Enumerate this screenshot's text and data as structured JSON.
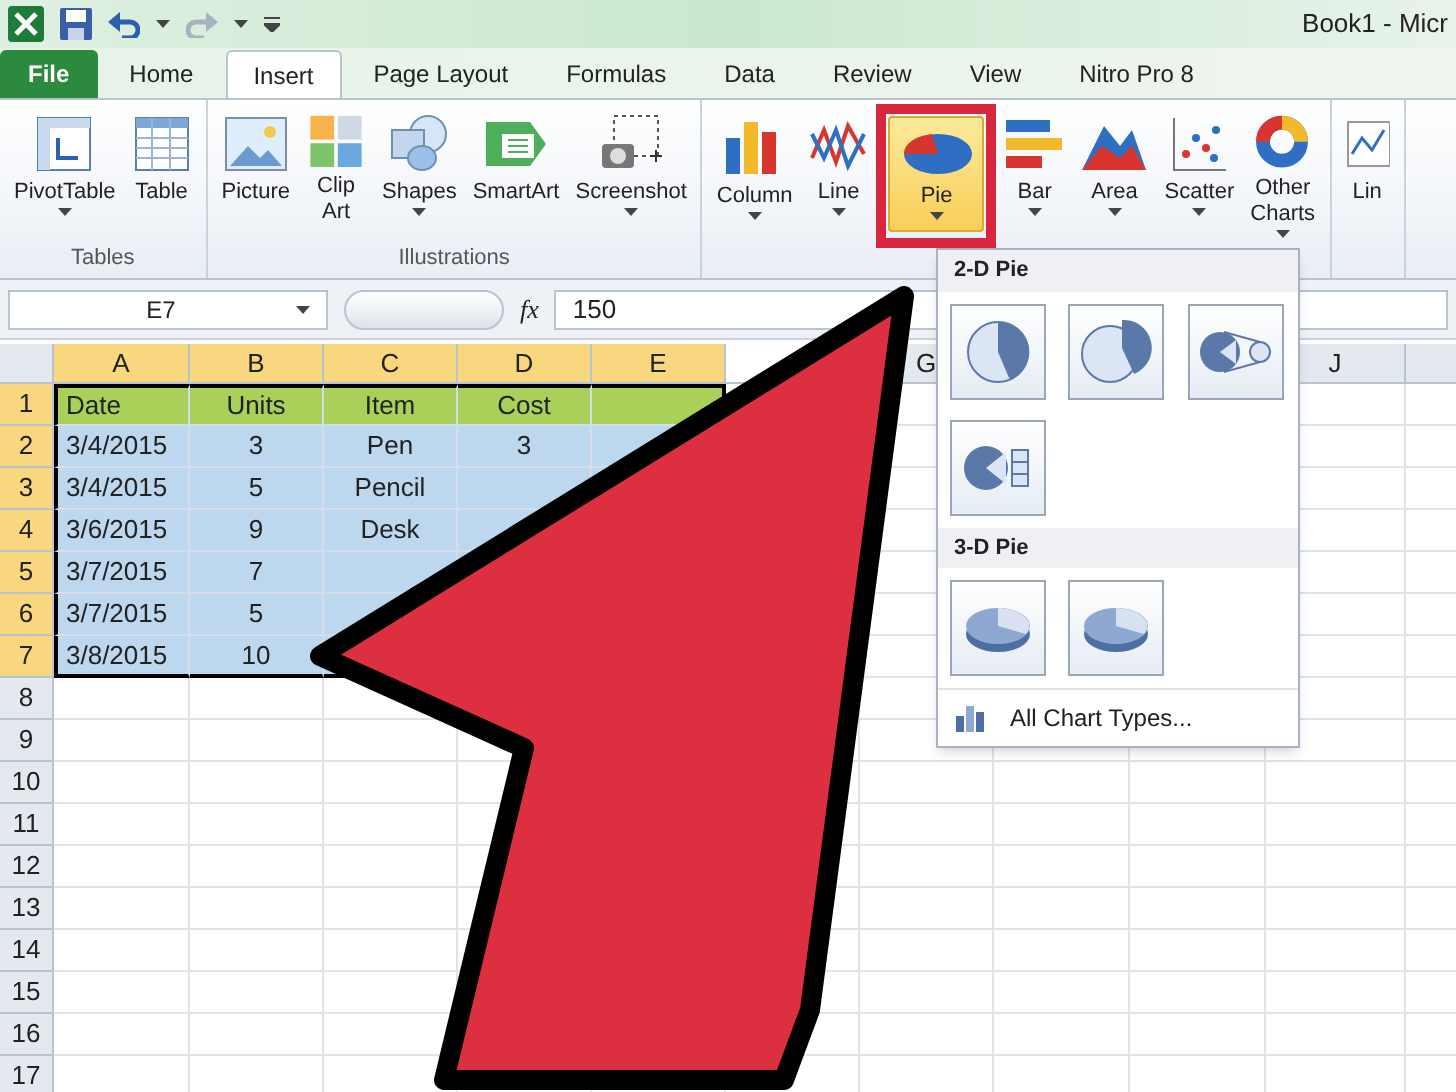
{
  "window": {
    "title": "Book1 - Micr"
  },
  "tabs": [
    {
      "label": "File",
      "kind": "file",
      "selected": false
    },
    {
      "label": "Home",
      "kind": "tab",
      "selected": false
    },
    {
      "label": "Insert",
      "kind": "tab",
      "selected": true
    },
    {
      "label": "Page Layout",
      "kind": "tab",
      "selected": false
    },
    {
      "label": "Formulas",
      "kind": "tab",
      "selected": false
    },
    {
      "label": "Data",
      "kind": "tab",
      "selected": false
    },
    {
      "label": "Review",
      "kind": "tab",
      "selected": false
    },
    {
      "label": "View",
      "kind": "tab",
      "selected": false
    },
    {
      "label": "Nitro Pro 8",
      "kind": "tab",
      "selected": false
    }
  ],
  "ribbon": {
    "groups": [
      {
        "label": "Tables",
        "buttons": [
          {
            "label": "PivotTable",
            "dropdown": true,
            "selected": false
          },
          {
            "label": "Table",
            "dropdown": false,
            "selected": false
          }
        ]
      },
      {
        "label": "Illustrations",
        "buttons": [
          {
            "label": "Picture",
            "dropdown": false,
            "selected": false
          },
          {
            "label": "Clip Art",
            "dropdown": false,
            "selected": false
          },
          {
            "label": "Shapes",
            "dropdown": true,
            "selected": false
          },
          {
            "label": "SmartArt",
            "dropdown": false,
            "selected": false
          },
          {
            "label": "Screenshot",
            "dropdown": true,
            "selected": false
          }
        ]
      },
      {
        "buttons": [
          {
            "label": "Column",
            "dropdown": true,
            "selected": false
          },
          {
            "label": "Line",
            "dropdown": true,
            "selected": false
          },
          {
            "label": "Pie",
            "dropdown": true,
            "selected": true
          },
          {
            "label": "Bar",
            "dropdown": true,
            "selected": false
          },
          {
            "label": "Area",
            "dropdown": true,
            "selected": false
          },
          {
            "label": "Scatter",
            "dropdown": true,
            "selected": false
          },
          {
            "label": "Other Charts",
            "dropdown": true,
            "selected": false
          }
        ]
      },
      {
        "buttons": [
          {
            "label": "Lin",
            "dropdown": false,
            "selected": false
          }
        ]
      }
    ]
  },
  "formula_bar": {
    "name_box": "E7",
    "fx": "fx",
    "value": "150"
  },
  "sheet": {
    "columns": [
      {
        "label": "A"
      },
      {
        "label": "B"
      },
      {
        "label": "C"
      },
      {
        "label": "D"
      },
      {
        "label": "E"
      },
      {},
      {
        "label": "G"
      },
      {},
      {},
      {
        "label": "J"
      }
    ],
    "rows": [
      {
        "number": "1",
        "kind": "header",
        "cells": [
          "Date",
          "Units",
          "Item",
          "Cost"
        ]
      },
      {
        "number": "2",
        "kind": "data",
        "cells": [
          "3/4/2015",
          "3",
          "Pen",
          "3"
        ]
      },
      {
        "number": "3",
        "kind": "data",
        "cells": [
          "3/4/2015",
          "5",
          "Pencil"
        ]
      },
      {
        "number": "4",
        "kind": "data",
        "cells": [
          "3/6/2015",
          "9",
          "Desk"
        ]
      },
      {
        "number": "5",
        "kind": "data",
        "cells": [
          "3/7/2015",
          "7"
        ]
      },
      {
        "number": "6",
        "kind": "data",
        "cells": [
          "3/7/2015",
          "5"
        ]
      },
      {
        "number": "7",
        "kind": "data",
        "cells": [
          "3/8/2015",
          "10"
        ]
      },
      {
        "number": "8",
        "kind": "empty",
        "cells": []
      },
      {
        "number": "9",
        "kind": "empty",
        "cells": []
      },
      {
        "number": "10",
        "kind": "empty",
        "cells": []
      },
      {
        "number": "11",
        "kind": "empty",
        "cells": []
      },
      {
        "number": "12",
        "kind": "empty",
        "cells": []
      },
      {
        "number": "13",
        "kind": "empty",
        "cells": []
      },
      {
        "number": "14",
        "kind": "empty",
        "cells": []
      },
      {
        "number": "15",
        "kind": "empty",
        "cells": []
      },
      {
        "number": "16",
        "kind": "empty",
        "cells": []
      },
      {
        "number": "17",
        "kind": "empty",
        "cells": []
      }
    ]
  },
  "pie_menu": {
    "sections": [
      {
        "title": "2-D Pie",
        "options": [
          {
            "selected": false
          },
          {
            "selected": false
          },
          {
            "selected": false
          },
          {
            "selected": false
          }
        ]
      },
      {
        "title": "3-D Pie",
        "options": [
          {
            "selected": false
          },
          {
            "selected": false
          }
        ]
      }
    ],
    "footer": "All Chart Types..."
  }
}
